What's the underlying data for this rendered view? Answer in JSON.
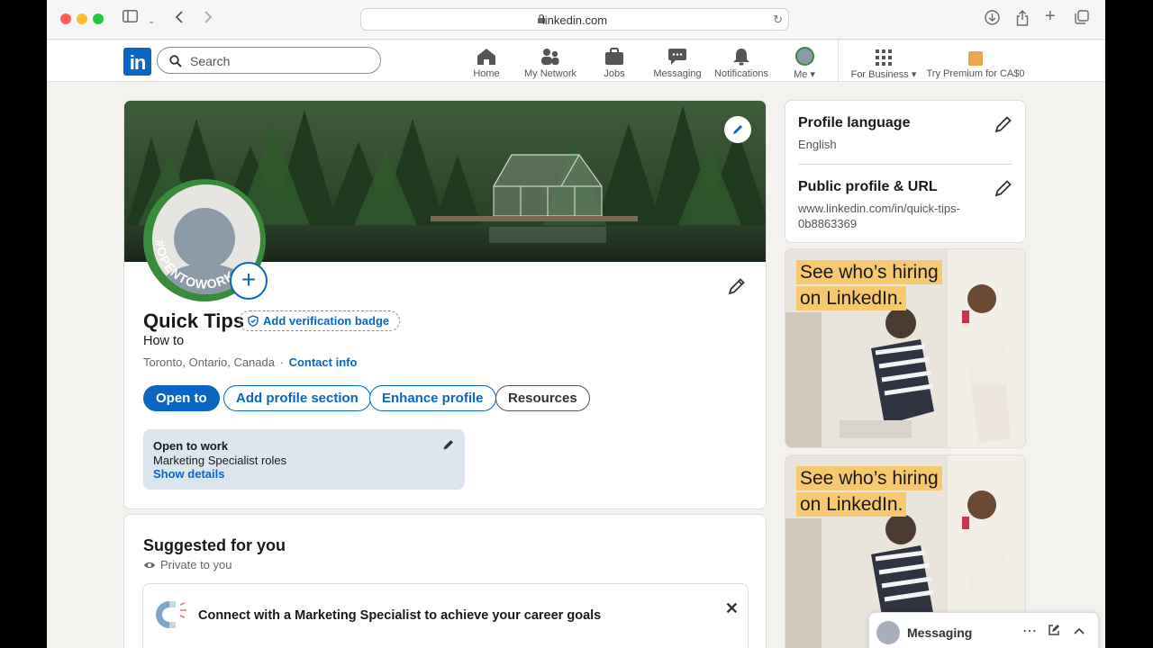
{
  "browser": {
    "url": "linkedin.com",
    "traffic_colors": [
      "#ff5f57",
      "#febc2e",
      "#28c840"
    ]
  },
  "nav": {
    "logo": "in",
    "search_placeholder": "Search",
    "items": [
      {
        "label": "Home",
        "icon": "home-icon"
      },
      {
        "label": "My Network",
        "icon": "network-icon"
      },
      {
        "label": "Jobs",
        "icon": "briefcase-icon"
      },
      {
        "label": "Messaging",
        "icon": "chat-icon"
      },
      {
        "label": "Notifications",
        "icon": "bell-icon"
      },
      {
        "label": "Me",
        "icon": "avatar"
      },
      {
        "label": "For Business",
        "icon": "grid-icon"
      },
      {
        "label": "Try Premium for CA$0",
        "icon": "premium-icon"
      }
    ],
    "accent": "#0a66c2"
  },
  "profile": {
    "name": "Quick Tips",
    "verification_badge": "Add verification badge",
    "headline": "How to",
    "location": "Toronto, Ontario, Canada",
    "separator": "·",
    "contact_info": "Contact info",
    "open_to_work_frame": "#OPENTOWORK",
    "buttons": {
      "open_to": "Open to",
      "add_section": "Add profile section",
      "enhance": "Enhance profile",
      "resources": "Resources"
    },
    "open_to_work": {
      "title": "Open to work",
      "roles": "Marketing Specialist roles",
      "details": "Show details"
    }
  },
  "suggested": {
    "title": "Suggested for you",
    "privacy": "Private to you",
    "item": "Connect with a Marketing Specialist to achieve your career goals"
  },
  "rail": {
    "language_title": "Profile language",
    "language_value": "English",
    "url_title": "Public profile & URL",
    "url_value_line1": "www.linkedin.com/in/quick-tips-",
    "url_value_line2": "0b8863369"
  },
  "ads": [
    {
      "line1": "See who’s hiring",
      "line2": "on LinkedIn."
    },
    {
      "line1": "See who’s hiring",
      "line2": "on LinkedIn."
    }
  ],
  "messaging_dock": {
    "label": "Messaging"
  }
}
